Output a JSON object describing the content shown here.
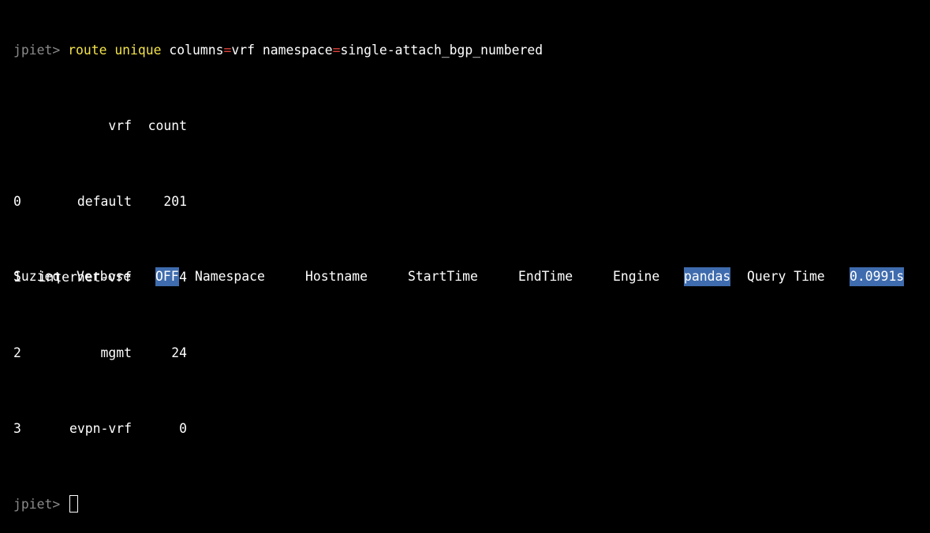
{
  "terminal": {
    "prompt": "jpiet>",
    "command": {
      "verb1": "route",
      "verb2": "unique",
      "arg1_key": "columns",
      "arg1_eq": "=",
      "arg1_val": "vrf",
      "arg2_key": "namespace",
      "arg2_eq": "=",
      "arg2_val": "single-attach_bgp_numbered"
    },
    "table": {
      "headers": {
        "vrf": "vrf",
        "count": "count"
      },
      "rows": [
        {
          "index": "0",
          "vrf": "default",
          "count": "201"
        },
        {
          "index": "1",
          "vrf": "internet-vrf",
          "count": "34"
        },
        {
          "index": "2",
          "vrf": "mgmt",
          "count": "24"
        },
        {
          "index": "3",
          "vrf": "evpn-vrf",
          "count": "0"
        }
      ]
    },
    "prompt2": "jpiet>"
  },
  "status_bar": {
    "app": "Suzieq",
    "verbose_label": "Verbose",
    "verbose_value": "OFF",
    "namespace_label": "Namespace",
    "hostname_label": "Hostname",
    "starttime_label": "StartTime",
    "endtime_label": "EndTime",
    "engine_label": "Engine",
    "engine_value": "pandas",
    "querytime_label": "Query Time",
    "querytime_value": "0.0991s"
  },
  "colors": {
    "background": "#000000",
    "prompt": "#8a8a8a",
    "command": "#f2e24b",
    "equals": "#e0443c",
    "highlight": "#3f6cae"
  }
}
